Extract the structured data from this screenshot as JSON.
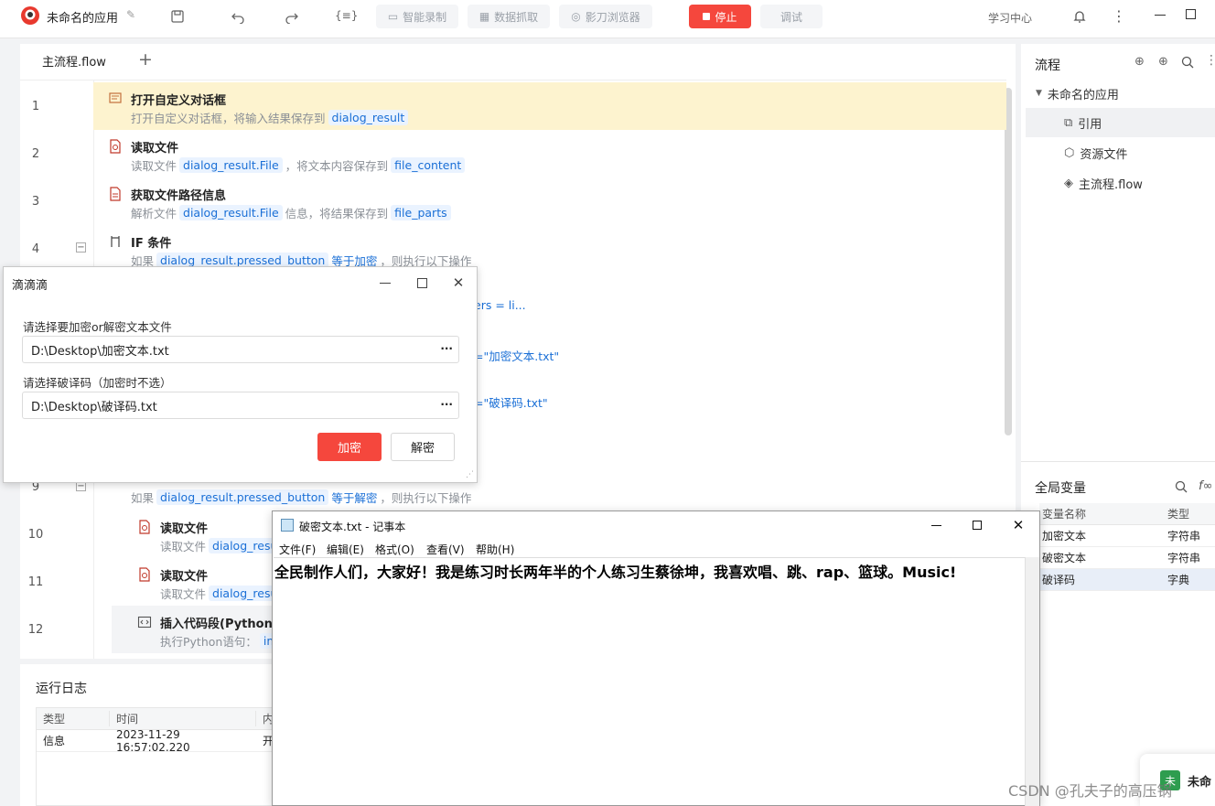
{
  "app": {
    "title": "未命名的应用"
  },
  "toolbar": {
    "variable_label": "{≡}",
    "smart_record": "智能录制",
    "data_capture": "数据抓取",
    "browser": "影刀浏览器",
    "stop": "停止",
    "debug": "调试",
    "learning_center": "学习中心"
  },
  "editor": {
    "tab_label": "主流程.flow",
    "add_tab": "+",
    "rows": [
      {
        "n": "1",
        "title": "打开自定义对话框",
        "desc": "打开自定义对话框，将输入结果保存到",
        "chip": "dialog_result"
      },
      {
        "n": "2",
        "title": "读取文件",
        "d1": "读取文件",
        "chip1": "dialog_result.File",
        "d2": "，将文本内容保存到",
        "chip2": "file_content"
      },
      {
        "n": "3",
        "title": "获取文件路径信息",
        "d1": "解析文件",
        "chip1": "dialog_result.File",
        "d2": "信息，将结果保存到",
        "chip2": "file_parts"
      },
      {
        "n": "4",
        "title": "IF 条件",
        "d1": "如果",
        "chip1": "dialog_result.pressed_button",
        "d2": "等于加密",
        "d3": "，则执行以下操作"
      },
      {
        "n": "9",
        "d1": "如果",
        "chip1": "dialog_result.pressed_button",
        "d2": "等于解密",
        "d3": "，则执行以下操作"
      },
      {
        "n": "10",
        "title": "读取文件",
        "d1": "读取文件",
        "chip1": "dialog_resu"
      },
      {
        "n": "11",
        "title": "读取文件",
        "d1": "读取文件",
        "chip1": "dialog_resu"
      },
      {
        "n": "12",
        "title": "插入代码段(Python)",
        "d1": "执行Python语句：",
        "chip1": "imp"
      }
    ],
    "frag_a": "ers = li...",
    "frag_b": "=\"加密文本.txt\"",
    "frag_c": "=\"破译码.txt\""
  },
  "right_panel": {
    "title": "流程",
    "tree": {
      "root": "未命名的应用",
      "ref": "引用",
      "resource": "资源文件",
      "main": "主流程.flow"
    },
    "vars_title": "全局变量",
    "vars_headers": [
      "变量名称",
      "类型"
    ],
    "vars": [
      {
        "name": "加密文本",
        "type": "字符串"
      },
      {
        "name": "破密文本",
        "type": "字符串"
      },
      {
        "name": "破译码",
        "type": "字典"
      }
    ]
  },
  "log": {
    "title": "运行日志",
    "headers": [
      "类型",
      "时间",
      "内"
    ],
    "rows": [
      {
        "type": "信息",
        "time": "2023-11-29 16:57:02.220",
        "content": "开"
      }
    ]
  },
  "dialog": {
    "title": "滴滴滴",
    "label1": "请选择要加密or解密文本文件",
    "field1": "D:\\Desktop\\加密文本.txt",
    "label2": "请选择破译码（加密时不选）",
    "field2": "D:\\Desktop\\破译码.txt",
    "browse": "···",
    "encrypt": "加密",
    "decrypt": "解密"
  },
  "notepad": {
    "title": "破密文本.txt - 记事本",
    "menu": [
      "文件(F)",
      "编辑(E)",
      "格式(O)",
      "查看(V)",
      "帮助(H)"
    ],
    "content": "全民制作人们，大家好！我是练习时长两年半的个人练习生蔡徐坤，我喜欢唱、跳、rap、篮球。Music!"
  },
  "corner": {
    "badge": "未",
    "text": "未命"
  },
  "watermark": "CSDN @孔夫子的高压锅",
  "colors": {
    "accent_red": "#f5473d",
    "chip_bg": "#eaf3ff",
    "chip_text": "#1a6fd6",
    "highlight_row": "#fdf3cf"
  }
}
